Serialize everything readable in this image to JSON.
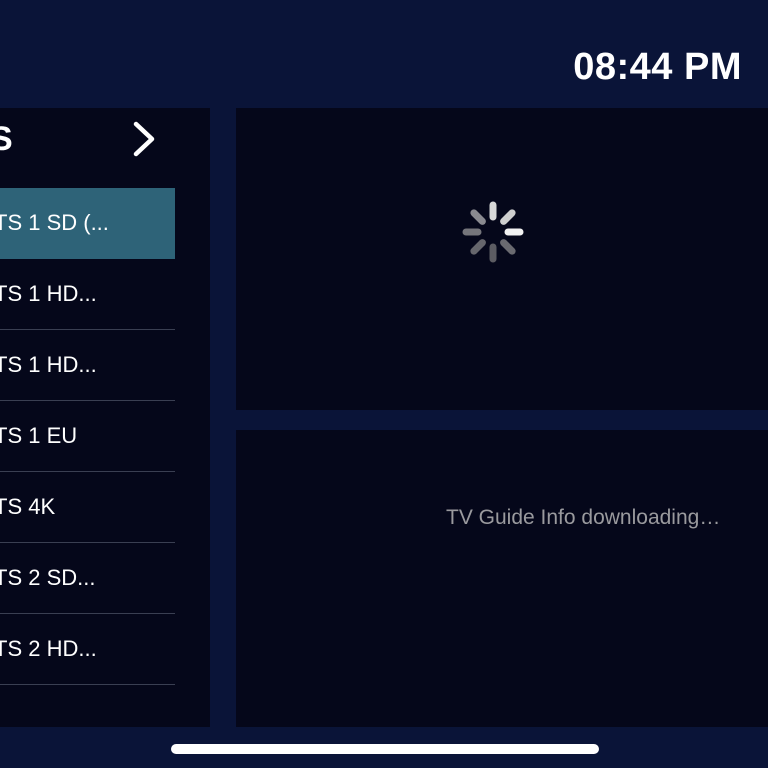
{
  "status": {
    "time": "08:44 PM"
  },
  "category": {
    "title": "S",
    "next_icon": "chevron-right-icon"
  },
  "channels": [
    {
      "label": "TS 1 SD (...",
      "selected": true
    },
    {
      "label": "TS 1 HD...",
      "selected": false
    },
    {
      "label": "TS 1 HD...",
      "selected": false
    },
    {
      "label": "TS 1 EU",
      "selected": false
    },
    {
      "label": "TS 4K",
      "selected": false
    },
    {
      "label": "TS 2 SD...",
      "selected": false
    },
    {
      "label": "TS 2 HD...",
      "selected": false
    }
  ],
  "preview": {
    "loading_icon": "spinner-icon"
  },
  "guide": {
    "message": "TV Guide Info downloading…"
  },
  "colors": {
    "background": "#0a1438",
    "panel": "#05071a",
    "selected": "#2e6378",
    "muted_text": "#9a9a9e"
  }
}
